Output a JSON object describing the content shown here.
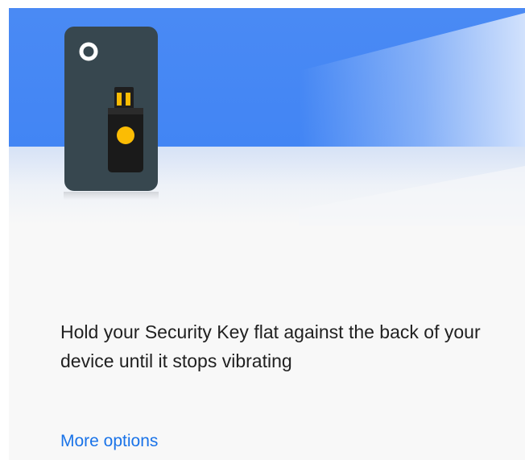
{
  "illustration": {
    "icon": "security-key-phone-icon",
    "colors": {
      "sky": "#4285f4",
      "phone": "#37474f",
      "key_body": "#1a1a1a",
      "key_contacts": "#fbbc04"
    }
  },
  "instruction": {
    "text": "Hold your Security Key flat against the back of your device until it stops vibrating"
  },
  "actions": {
    "more_options_label": "More options",
    "link_color": "#1a73e8"
  }
}
